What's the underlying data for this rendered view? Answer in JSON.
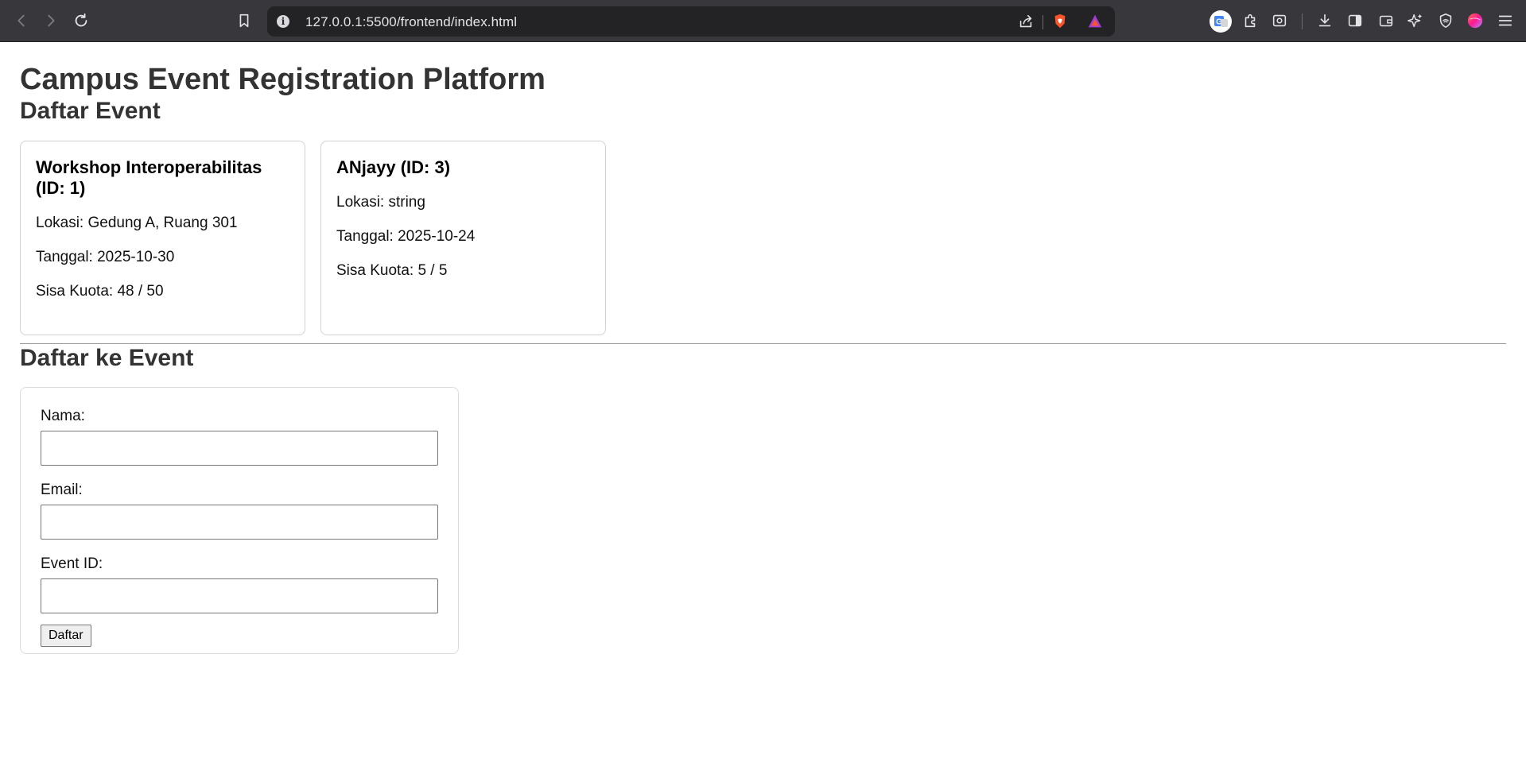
{
  "browser": {
    "url": "127.0.0.1:5500/frontend/index.html",
    "icons": [
      "back-icon",
      "forward-icon",
      "reload-icon",
      "bookmark-icon",
      "site-info-icon",
      "share-icon",
      "brave-shields-icon",
      "brave-rewards-icon",
      "google-translate-icon",
      "extensions-icon",
      "screenshot-icon",
      "downloads-icon",
      "sidebar-icon",
      "wallet-icon",
      "leo-ai-icon",
      "vpn-icon",
      "profile-icon",
      "menu-icon"
    ]
  },
  "page": {
    "title": "Campus Event Registration Platform"
  },
  "events_section": {
    "heading": "Daftar Event",
    "events": [
      {
        "title": "Workshop Interoperabilitas (ID: 1)",
        "location": "Lokasi: Gedung A, Ruang 301",
        "date": "Tanggal: 2025-10-30",
        "quota": "Sisa Kuota: 48 / 50"
      },
      {
        "title": "ANjayy (ID: 3)",
        "location": "Lokasi: string",
        "date": "Tanggal: 2025-10-24",
        "quota": "Sisa Kuota: 5 / 5"
      }
    ]
  },
  "register_section": {
    "heading": "Daftar ke Event",
    "name_label": "Nama:",
    "name_value": "",
    "email_label": "Email:",
    "email_value": "",
    "event_id_label": "Event ID:",
    "event_id_value": "",
    "submit_label": "Daftar"
  }
}
